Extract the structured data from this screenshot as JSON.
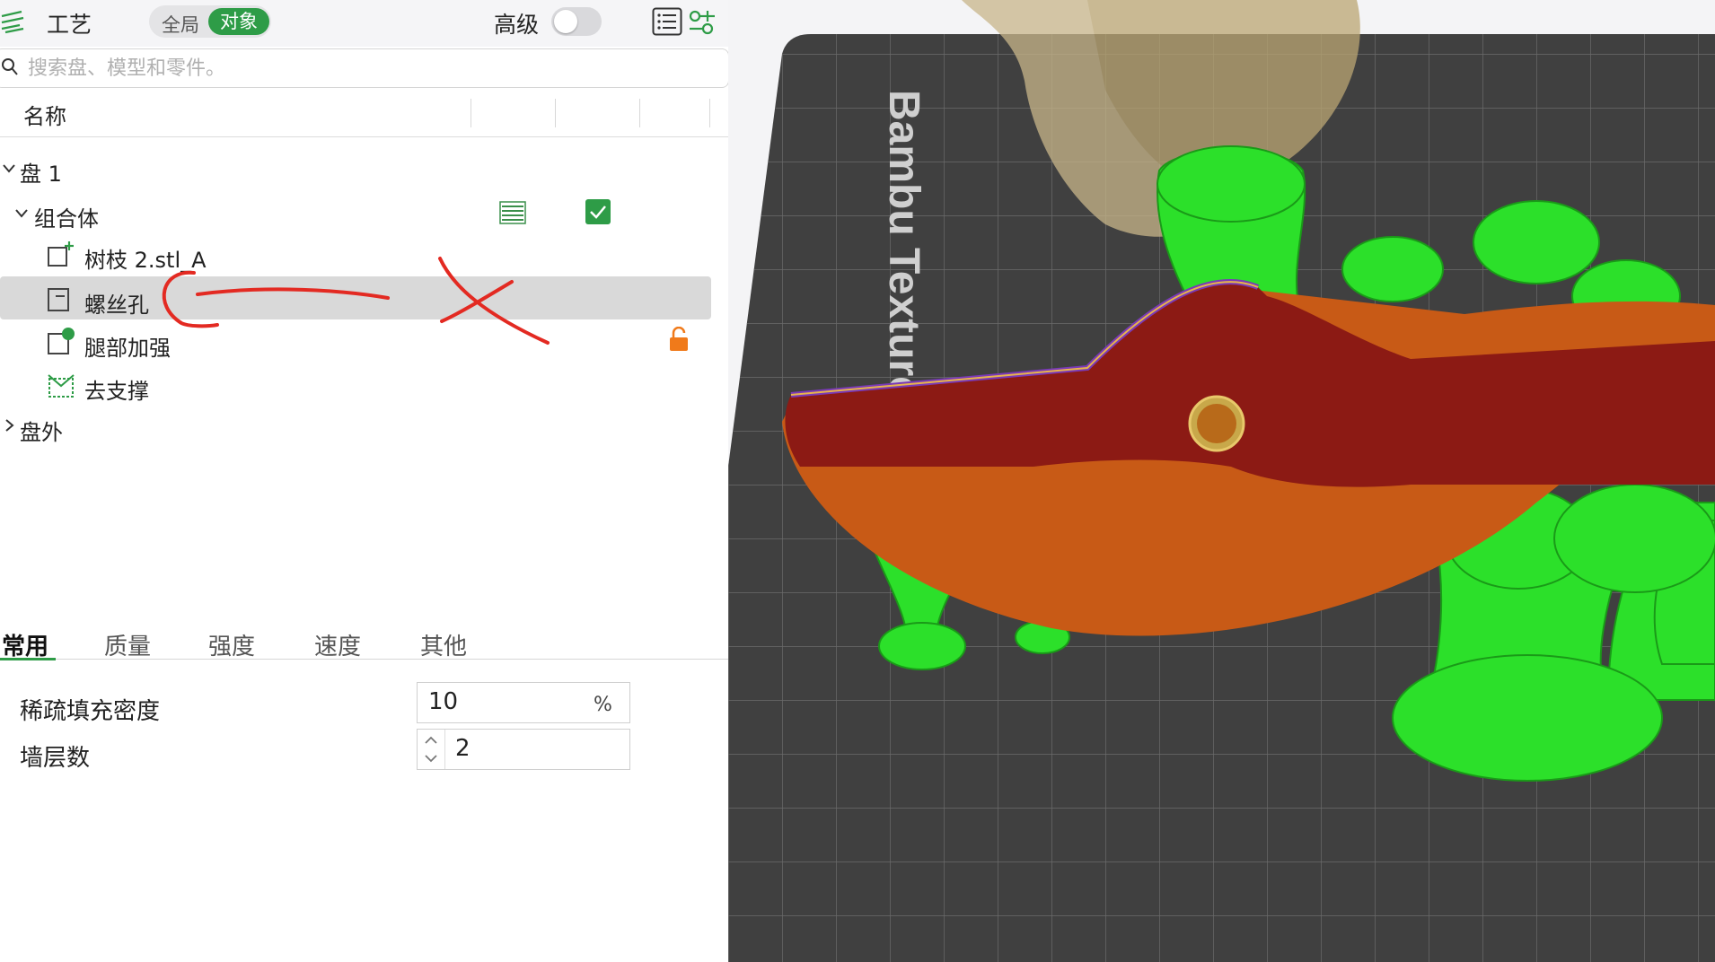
{
  "header": {
    "title": "工艺",
    "scope_global": "全局",
    "scope_object": "对象",
    "advanced_label": "高级"
  },
  "search": {
    "placeholder": "搜索盘、模型和零件。"
  },
  "columns": {
    "name": "名称"
  },
  "tree": {
    "plate": "盘 1",
    "assembly": "组合体",
    "items": [
      "树枝 2.stl_A",
      "螺丝孔",
      "腿部加强",
      "去支撑"
    ],
    "outside": "盘外"
  },
  "tabs": [
    "常用",
    "质量",
    "强度",
    "速度",
    "其他"
  ],
  "settings": {
    "infill_label": "稀疏填充密度",
    "infill_value": "10",
    "infill_unit": "%",
    "walls_label": "墙层数",
    "walls_value": "2"
  },
  "viewport": {
    "bed_label": "Bambu Textured"
  },
  "colors": {
    "accent": "#2e9c47",
    "support": "#2ce02a",
    "model": "#c85a16",
    "infill": "#8c1a14",
    "bed": "#404040",
    "annotation": "#e32a22",
    "lock": "#f07a1a"
  }
}
